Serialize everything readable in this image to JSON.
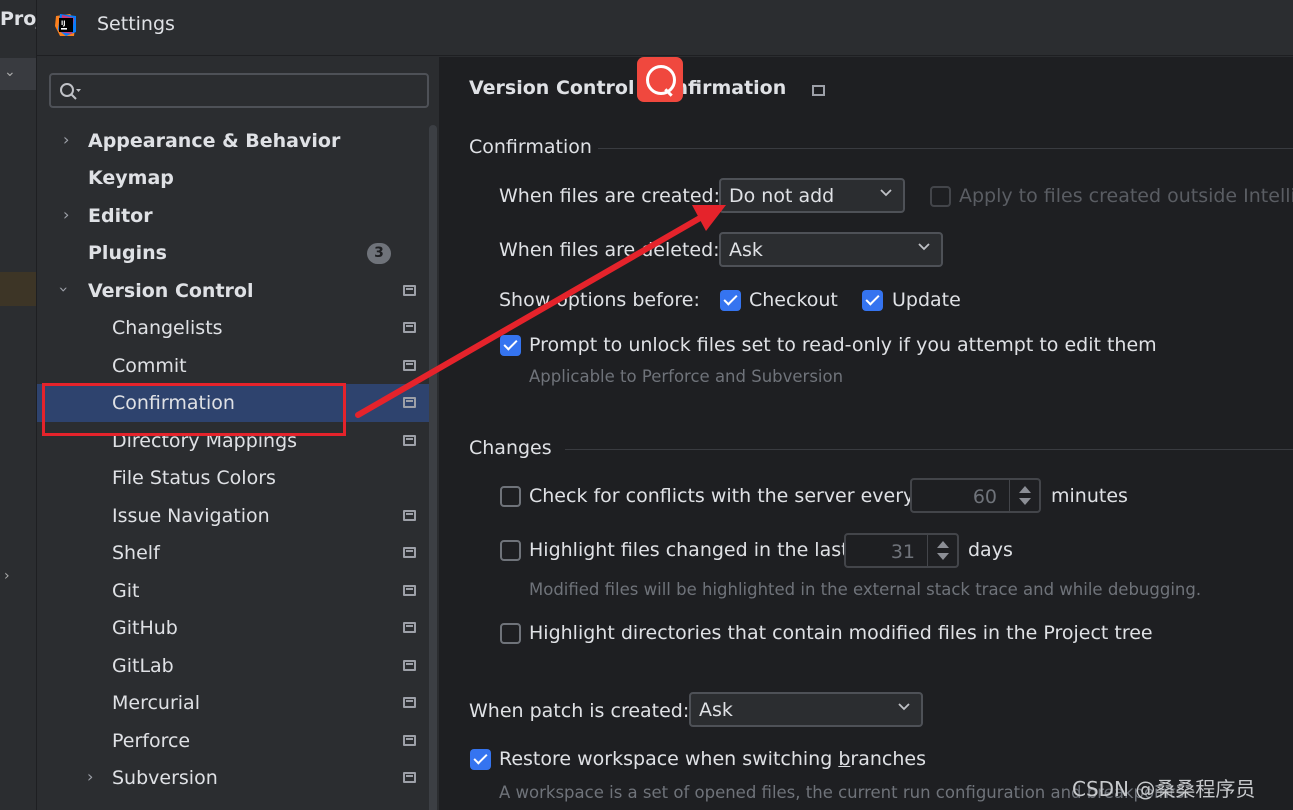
{
  "ide": {
    "project_label": "Proj"
  },
  "window": {
    "title": "Settings"
  },
  "search": {
    "placeholder": ""
  },
  "tree": {
    "appearance": "Appearance & Behavior",
    "keymap": "Keymap",
    "editor": "Editor",
    "plugins": "Plugins",
    "plugins_badge": "3",
    "version_control": "Version Control",
    "changelists": "Changelists",
    "commit": "Commit",
    "confirmation": "Confirmation",
    "directory_mappings": "Directory Mappings",
    "file_status_colors": "File Status Colors",
    "issue_navigation": "Issue Navigation",
    "shelf": "Shelf",
    "git": "Git",
    "github": "GitHub",
    "gitlab": "GitLab",
    "mercurial": "Mercurial",
    "perforce": "Perforce",
    "subversion": "Subversion"
  },
  "breadcrumb": {
    "parent": "Version Control",
    "current_partial": "nfirmation"
  },
  "confirmation": {
    "heading": "Confirmation",
    "files_created_label": "When files are created:",
    "files_created_value": "Do not add",
    "apply_outside_label": "Apply to files created outside IntelliJ",
    "files_deleted_label": "When files are deleted:",
    "files_deleted_value": "Ask",
    "show_options_label": "Show options before:",
    "checkout_label": "Checkout",
    "update_label": "Update",
    "prompt_unlock_label": "Prompt to unlock files set to read-only if you attempt to edit them",
    "prompt_unlock_hint": "Applicable to Perforce and Subversion"
  },
  "changes": {
    "heading": "Changes",
    "conflicts_label": "Check for conflicts with the server every",
    "conflicts_value": "60",
    "conflicts_unit": "minutes",
    "highlight_label": "Highlight files changed in the last",
    "highlight_value": "31",
    "highlight_unit": "days",
    "highlight_hint": "Modified files will be highlighted in the external stack trace and while debugging.",
    "highlight_dirs_label": "Highlight directories that contain modified files in the Project tree"
  },
  "patch": {
    "label": "When patch is created:",
    "value": "Ask"
  },
  "restore": {
    "label_before": "Restore workspace when switching ",
    "label_mnemonic": "b",
    "label_after": "ranches",
    "hint": "A workspace is a set of opened files, the current run configuration and breakpoints."
  },
  "watermark": "CSDN @桑桑程序员",
  "colors": {
    "accent": "#3574f0",
    "selection": "#2e436e",
    "annotation": "#e5232b",
    "csdn_brand": "#f0483e"
  }
}
